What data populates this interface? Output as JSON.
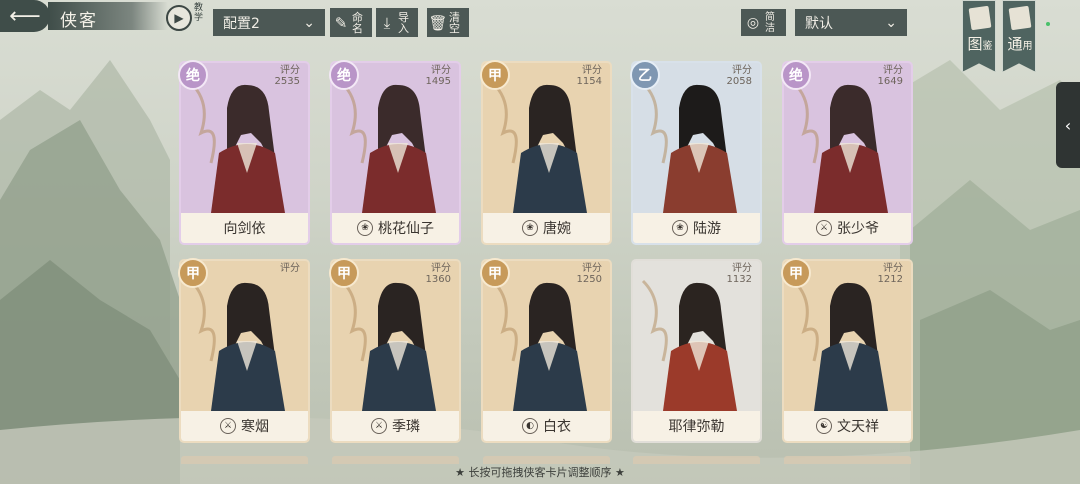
{
  "header": {
    "back_icon": "arrow-left-icon",
    "title": "侠客",
    "tutorial_label": "教学",
    "config_value": "配置2",
    "rename_label": "命名",
    "import_label": "导入",
    "clear_label": "清空",
    "simple_label": "简洁",
    "sort_value": "默认",
    "atlas_label": "图",
    "atlas_sub": "鉴",
    "general_label": "通",
    "general_sub": "用"
  },
  "cards": [
    {
      "name": "向剑依",
      "rank": "绝",
      "score_label": "评分",
      "score": "2535",
      "rarity": "purple",
      "name_icon": ""
    },
    {
      "name": "桃花仙子",
      "rank": "绝",
      "score_label": "评分",
      "score": "1495",
      "rarity": "purple",
      "name_icon": "lotus-icon"
    },
    {
      "name": "唐婉",
      "rank": "甲",
      "score_label": "评分",
      "score": "1154",
      "rarity": "gold",
      "name_icon": "lotus-icon"
    },
    {
      "name": "陆游",
      "rank": "乙",
      "score_label": "评分",
      "score": "2058",
      "rarity": "blue",
      "name_icon": "lotus-icon"
    },
    {
      "name": "张少爷",
      "rank": "绝",
      "score_label": "评分",
      "score": "1649",
      "rarity": "purple",
      "name_icon": "sword-icon"
    },
    {
      "name": "寒烟",
      "rank": "甲",
      "score_label": "评分",
      "score": "",
      "rarity": "gold",
      "name_icon": "sword-icon"
    },
    {
      "name": "季璘",
      "rank": "甲",
      "score_label": "评分",
      "score": "1360",
      "rarity": "gold",
      "name_icon": "sword-icon"
    },
    {
      "name": "白衣",
      "rank": "甲",
      "score_label": "评分",
      "score": "1250",
      "rarity": "gold",
      "name_icon": "shield-icon"
    },
    {
      "name": "耶律弥勒",
      "rank": "",
      "score_label": "评分",
      "score": "1132",
      "rarity": "grey",
      "name_icon": ""
    },
    {
      "name": "文天祥",
      "rank": "甲",
      "score_label": "评分",
      "score": "1212",
      "rarity": "gold",
      "name_icon": "yinyang-icon"
    }
  ],
  "footer": {
    "tip": "长按可拖拽侠客卡片调整顺序"
  }
}
